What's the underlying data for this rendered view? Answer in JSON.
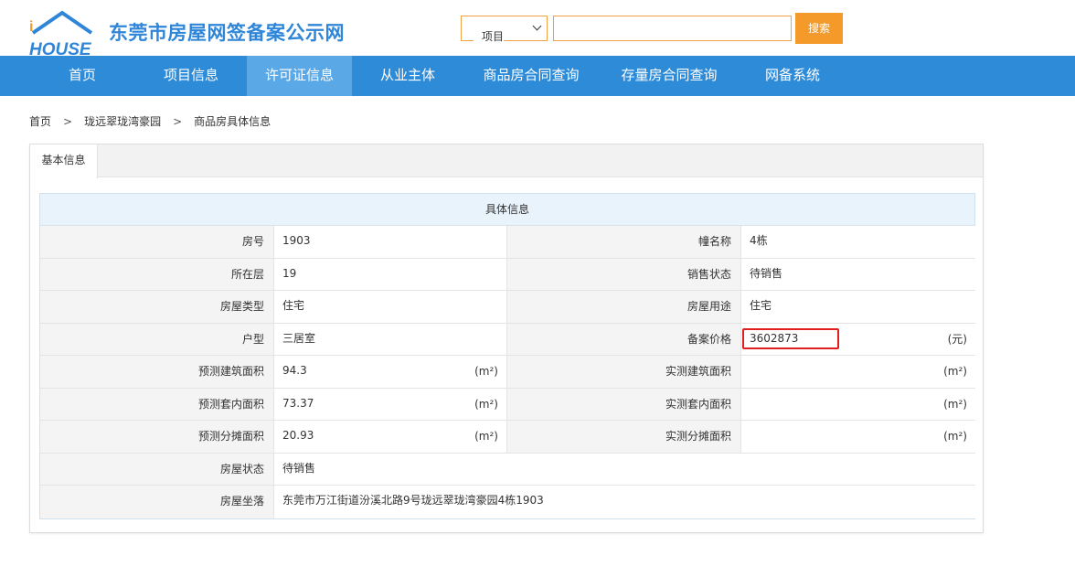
{
  "header": {
    "logo_text": "HOUSE",
    "site_title": "东莞市房屋网签备案公示网",
    "search": {
      "select_value": "项目",
      "input_value": "",
      "button_label": "搜索"
    }
  },
  "nav": {
    "items": [
      {
        "label": "首页"
      },
      {
        "label": "项目信息"
      },
      {
        "label": "许可证信息"
      },
      {
        "label": "从业主体"
      },
      {
        "label": "商品房合同查询"
      },
      {
        "label": "存量房合同查询"
      },
      {
        "label": "网备系统"
      }
    ],
    "active_index": 2
  },
  "breadcrumb": {
    "items": [
      "首页",
      "珑远翠珑湾豪园",
      "商品房具体信息"
    ],
    "separator": ">"
  },
  "tab": {
    "label": "基本信息"
  },
  "table": {
    "title": "具体信息",
    "rows": [
      {
        "l1": "房号",
        "v1": "1903",
        "u1": "",
        "l2": "幢名称",
        "v2": "4栋",
        "u2": ""
      },
      {
        "l1": "所在层",
        "v1": "19",
        "u1": "",
        "l2": "销售状态",
        "v2": "待销售",
        "u2": ""
      },
      {
        "l1": "房屋类型",
        "v1": "住宅",
        "u1": "",
        "l2": "房屋用途",
        "v2": "住宅",
        "u2": ""
      },
      {
        "l1": "户型",
        "v1": "三居室",
        "u1": "",
        "l2": "备案价格",
        "v2": "3602873",
        "u2": "(元)"
      },
      {
        "l1": "预测建筑面积",
        "v1": "94.3",
        "u1": "(m²)",
        "l2": "实测建筑面积",
        "v2": "",
        "u2": "(m²)"
      },
      {
        "l1": "预测套内面积",
        "v1": "73.37",
        "u1": "(m²)",
        "l2": "实测套内面积",
        "v2": "",
        "u2": "(m²)"
      },
      {
        "l1": "预测分摊面积",
        "v1": "20.93",
        "u1": "(m²)",
        "l2": "实测分摊面积",
        "v2": "",
        "u2": "(m²)"
      }
    ],
    "wide_rows": [
      {
        "label": "房屋状态",
        "value": "待销售"
      },
      {
        "label": "房屋坐落",
        "value": "东莞市万江街道汾溪北路9号珑远翠珑湾豪园4栋1903"
      }
    ]
  },
  "colors": {
    "brand": "#2f86d8",
    "nav_bg": "#2e8bd8",
    "nav_active": "#5aa8e6",
    "search_button": "#f39a2b",
    "highlight": "#e02020"
  }
}
